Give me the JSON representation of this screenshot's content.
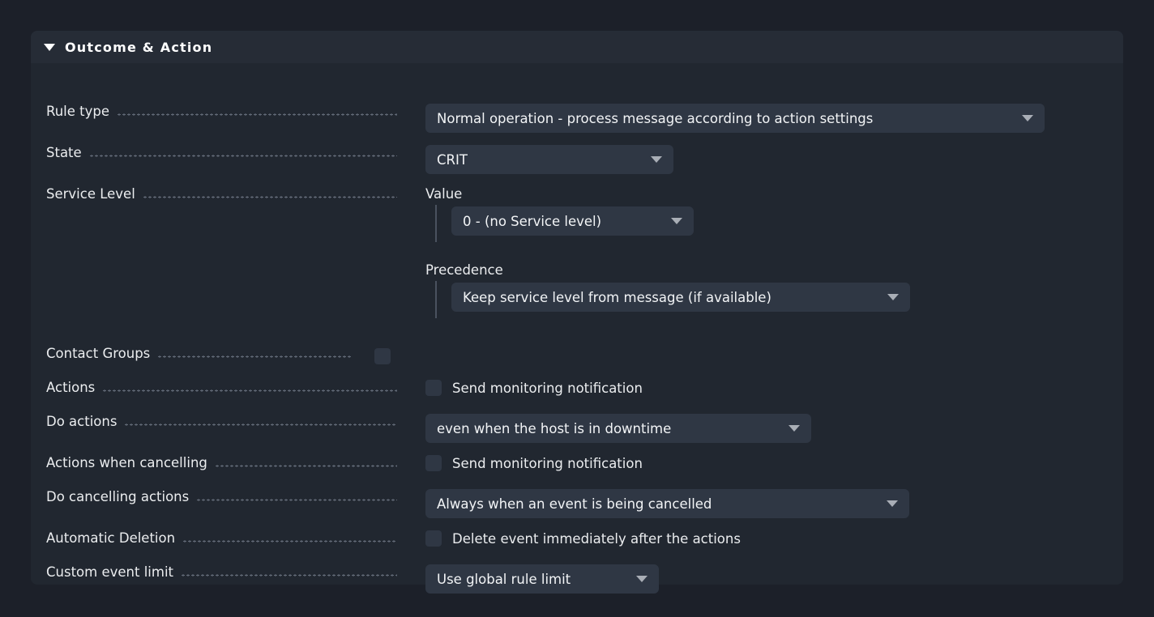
{
  "panel": {
    "title": "Outcome & Action",
    "collapse_icon": "caret-down-icon"
  },
  "rows": {
    "rule_type": {
      "label": "Rule type",
      "value": "Normal operation - process message according to action settings"
    },
    "state": {
      "label": "State",
      "value": "CRIT"
    },
    "service_level": {
      "label": "Service Level",
      "value_title": "Value",
      "value": "0 - (no Service level)",
      "precedence_title": "Precedence",
      "precedence": "Keep service level from message (if available)"
    },
    "contact_groups": {
      "label": "Contact Groups",
      "checked": false
    },
    "actions": {
      "label": "Actions",
      "checkbox_label": "Send monitoring notification",
      "checked": false
    },
    "do_actions": {
      "label": "Do actions",
      "value": "even when the host is in downtime"
    },
    "actions_when_cancelling": {
      "label": "Actions when cancelling",
      "checkbox_label": "Send monitoring notification",
      "checked": false
    },
    "do_cancelling_actions": {
      "label": "Do cancelling actions",
      "value": "Always when an event is being cancelled"
    },
    "automatic_deletion": {
      "label": "Automatic Deletion",
      "checkbox_label": "Delete event immediately after the actions",
      "checked": false
    },
    "custom_event_limit": {
      "label": "Custom event limit",
      "value": "Use global rule limit"
    }
  },
  "colors": {
    "page_background": "#1c2029",
    "panel_background": "#212730",
    "header_background": "#262c36",
    "control_background": "#2f3744",
    "text": "#ebedef",
    "arrow": "#a9aeb6",
    "leader": "#6c7582"
  }
}
